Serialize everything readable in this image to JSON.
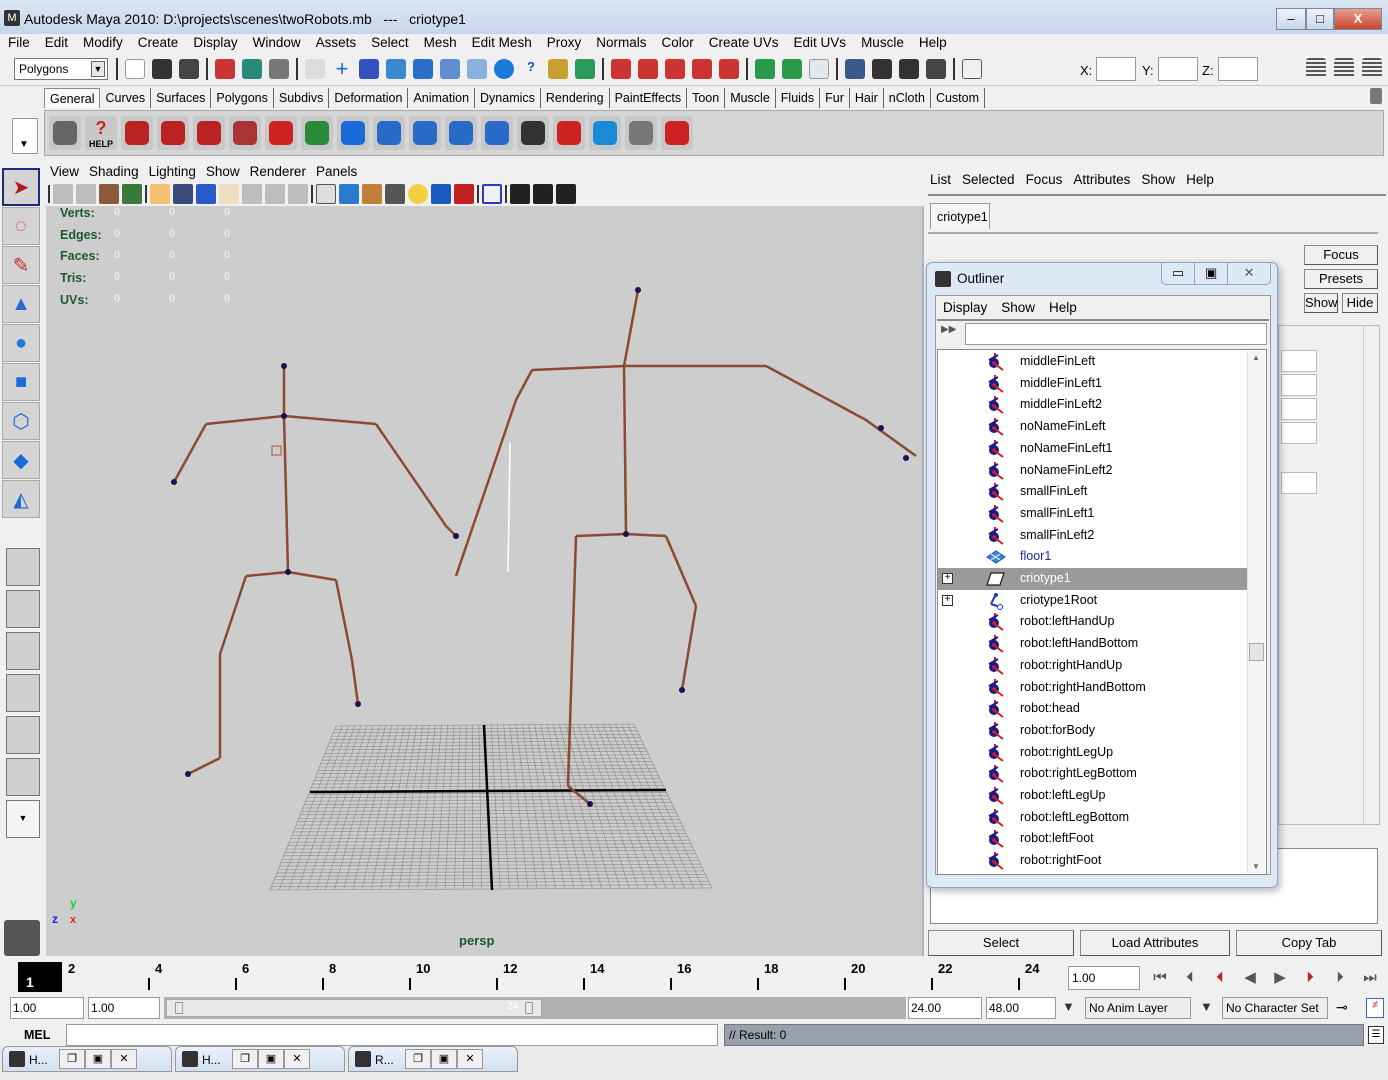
{
  "window": {
    "title": "Autodesk Maya 2010: D:\\projects\\scenes\\twoRobots.mb   ---   criotype1",
    "min_label": "–",
    "max_label": "□",
    "close_label": "X"
  },
  "menubar": [
    "File",
    "Edit",
    "Modify",
    "Create",
    "Display",
    "Window",
    "Assets",
    "Select",
    "Mesh",
    "Edit Mesh",
    "Proxy",
    "Normals",
    "Color",
    "Create UVs",
    "Edit UVs",
    "Muscle",
    "Help"
  ],
  "statusline": {
    "menu_set": "Polygons",
    "x_label": "X:",
    "y_label": "Y:",
    "z_label": "Z:",
    "x_value": "",
    "y_value": "",
    "z_value": ""
  },
  "shelf": {
    "tabs": [
      "General",
      "Curves",
      "Surfaces",
      "Polygons",
      "Subdivs",
      "Deformation",
      "Animation",
      "Dynamics",
      "Rendering",
      "PaintEffects",
      "Toon",
      "Muscle",
      "Fluids",
      "Fur",
      "Hair",
      "nCloth",
      "Custom"
    ],
    "active_tab": "General",
    "icons": [
      "film-reel-icon",
      "help-icon",
      "camera-tumble-icon",
      "camera-track-icon",
      "camera-dolly-icon",
      "camera-zoom-icon",
      "undo-icon",
      "redo-icon",
      "delete-history-icon",
      "hierarchy-icon",
      "hierarchy-2-icon",
      "hierarchy-3-icon",
      "hierarchy-4-icon",
      "script-editor-icon",
      "select-red-icon",
      "select-mesh-icon",
      "select-cube-icon",
      "paint-tool-icon"
    ],
    "help_label": "HELP"
  },
  "viewport": {
    "menu": [
      "View",
      "Shading",
      "Lighting",
      "Show",
      "Renderer",
      "Panels"
    ],
    "hud": [
      {
        "label": "Verts:",
        "values": [
          "0",
          "0",
          "0"
        ]
      },
      {
        "label": "Edges:",
        "values": [
          "0",
          "0",
          "0"
        ]
      },
      {
        "label": "Faces:",
        "values": [
          "0",
          "0",
          "0"
        ]
      },
      {
        "label": "Tris:",
        "values": [
          "0",
          "0",
          "0"
        ]
      },
      {
        "label": "UVs:",
        "values": [
          "0",
          "0",
          "0"
        ]
      }
    ],
    "camera_label": "persp",
    "axis": {
      "y": "y",
      "z": "z",
      "x": "x"
    },
    "colors": {
      "bone": "#8b4a32",
      "joint": "#1e1050",
      "grid": "#8a8a8a",
      "bg": "#cdcdcd"
    }
  },
  "attribute_editor": {
    "menu": [
      "List",
      "Selected",
      "Focus",
      "Attributes",
      "Show",
      "Help"
    ],
    "tab": "criotype1",
    "focus_label": "Focus",
    "presets_label": "Presets",
    "show_label": "Show",
    "hide_label": "Hide",
    "select_label": "Select",
    "load_attributes_label": "Load Attributes",
    "copy_tab_label": "Copy Tab"
  },
  "outliner": {
    "title": "Outliner",
    "menu": [
      "Display",
      "Show",
      "Help"
    ],
    "filter_value": "",
    "items": [
      {
        "label": "middleFinLeft",
        "icon": "joint",
        "expandable": false,
        "selected": false
      },
      {
        "label": "middleFinLeft1",
        "icon": "joint",
        "expandable": false,
        "selected": false
      },
      {
        "label": "middleFinLeft2",
        "icon": "joint",
        "expandable": false,
        "selected": false
      },
      {
        "label": "noNameFinLeft",
        "icon": "joint",
        "expandable": false,
        "selected": false
      },
      {
        "label": "noNameFinLeft1",
        "icon": "joint",
        "expandable": false,
        "selected": false
      },
      {
        "label": "noNameFinLeft2",
        "icon": "joint",
        "expandable": false,
        "selected": false
      },
      {
        "label": "smallFinLeft",
        "icon": "joint",
        "expandable": false,
        "selected": false
      },
      {
        "label": "smallFinLeft1",
        "icon": "joint",
        "expandable": false,
        "selected": false
      },
      {
        "label": "smallFinLeft2",
        "icon": "joint",
        "expandable": false,
        "selected": false
      },
      {
        "label": "floor1",
        "icon": "mesh",
        "expandable": false,
        "selected": false
      },
      {
        "label": "criotype1",
        "icon": "character",
        "expandable": true,
        "selected": true
      },
      {
        "label": "criotype1Root",
        "icon": "root",
        "expandable": true,
        "selected": false
      },
      {
        "label": "robot:leftHandUp",
        "icon": "joint",
        "expandable": false,
        "selected": false
      },
      {
        "label": "robot:leftHandBottom",
        "icon": "joint",
        "expandable": false,
        "selected": false
      },
      {
        "label": "robot:rightHandUp",
        "icon": "joint",
        "expandable": false,
        "selected": false
      },
      {
        "label": "robot:rightHandBottom",
        "icon": "joint",
        "expandable": false,
        "selected": false
      },
      {
        "label": "robot:head",
        "icon": "joint",
        "expandable": false,
        "selected": false
      },
      {
        "label": "robot:forBody",
        "icon": "joint",
        "expandable": false,
        "selected": false
      },
      {
        "label": "robot:rightLegUp",
        "icon": "joint",
        "expandable": false,
        "selected": false
      },
      {
        "label": "robot:rightLegBottom",
        "icon": "joint",
        "expandable": false,
        "selected": false
      },
      {
        "label": "robot:leftLegUp",
        "icon": "joint",
        "expandable": false,
        "selected": false
      },
      {
        "label": "robot:leftLegBottom",
        "icon": "joint",
        "expandable": false,
        "selected": false
      },
      {
        "label": "robot:leftFoot",
        "icon": "joint",
        "expandable": false,
        "selected": false
      },
      {
        "label": "robot:rightFoot",
        "icon": "joint",
        "expandable": false,
        "selected": false
      }
    ]
  },
  "timeline": {
    "current_frame": "1",
    "ticks": [
      "2",
      "4",
      "6",
      "8",
      "10",
      "12",
      "14",
      "16",
      "18",
      "20",
      "22",
      "24"
    ],
    "current_time_field": "1.00",
    "start_time": "1.00",
    "playback_start": "1.00",
    "playback_end": "24.00",
    "end_time": "48.00",
    "range_start_marker": "1",
    "range_end_marker": "24",
    "anim_layer": "No Anim Layer",
    "character_set": "No Character Set",
    "playback_buttons": [
      "go-to-start-icon",
      "step-back-frame-icon",
      "step-back-key-icon",
      "play-backward-icon",
      "play-forward-icon",
      "step-forward-key-icon",
      "step-forward-frame-icon",
      "go-to-end-icon"
    ]
  },
  "command_line": {
    "mode": "MEL",
    "input_value": "",
    "result": "// Result: 0"
  },
  "taskbar": [
    {
      "label": "H..."
    },
    {
      "label": "H..."
    },
    {
      "label": "R..."
    }
  ]
}
